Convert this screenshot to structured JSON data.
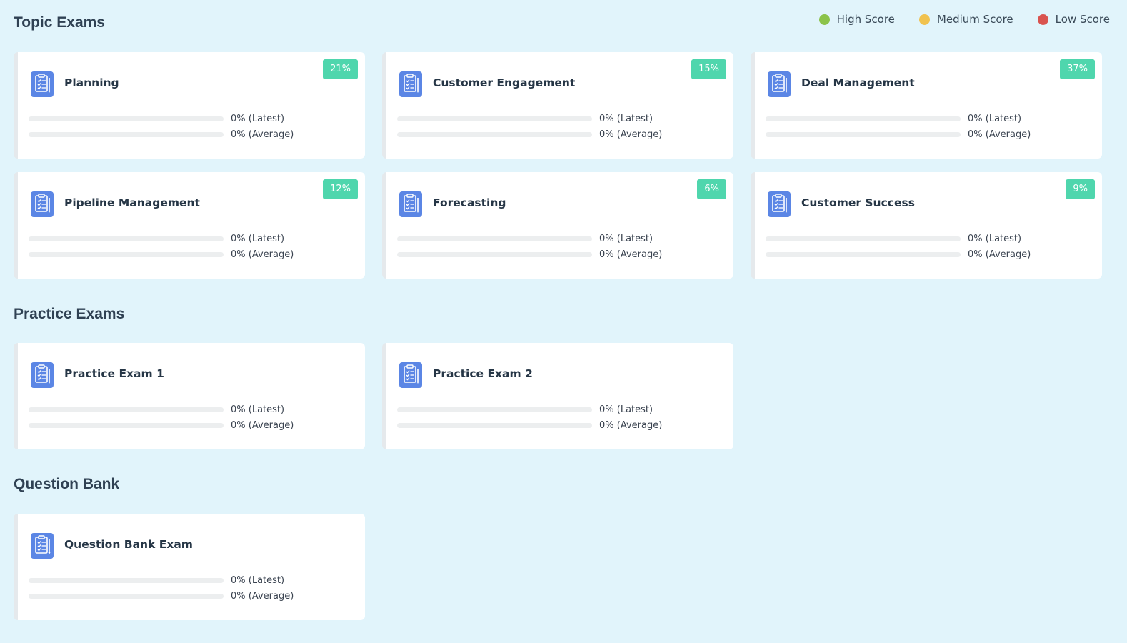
{
  "legend": [
    {
      "label": "High Score",
      "color": "#8bc34a"
    },
    {
      "label": "Medium Score",
      "color": "#f0c24f"
    },
    {
      "label": "Low Score",
      "color": "#d9534f"
    }
  ],
  "sections": {
    "topic": {
      "title": "Topic Exams",
      "cards": [
        {
          "title": "Planning",
          "badge": "21%",
          "latest": "0% (Latest)",
          "average": "0% (Average)",
          "latest_pct": 0,
          "average_pct": 0
        },
        {
          "title": "Customer Engagement",
          "badge": "15%",
          "latest": "0% (Latest)",
          "average": "0% (Average)",
          "latest_pct": 0,
          "average_pct": 0
        },
        {
          "title": "Deal Management",
          "badge": "37%",
          "latest": "0% (Latest)",
          "average": "0% (Average)",
          "latest_pct": 0,
          "average_pct": 0
        },
        {
          "title": "Pipeline Management",
          "badge": "12%",
          "latest": "0% (Latest)",
          "average": "0% (Average)",
          "latest_pct": 0,
          "average_pct": 0
        },
        {
          "title": "Forecasting",
          "badge": "6%",
          "latest": "0% (Latest)",
          "average": "0% (Average)",
          "latest_pct": 0,
          "average_pct": 0
        },
        {
          "title": "Customer Success",
          "badge": "9%",
          "latest": "0% (Latest)",
          "average": "0% (Average)",
          "latest_pct": 0,
          "average_pct": 0
        }
      ]
    },
    "practice": {
      "title": "Practice Exams",
      "cards": [
        {
          "title": "Practice Exam 1",
          "latest": "0% (Latest)",
          "average": "0% (Average)",
          "latest_pct": 0,
          "average_pct": 0
        },
        {
          "title": "Practice Exam 2",
          "latest": "0% (Latest)",
          "average": "0% (Average)",
          "latest_pct": 0,
          "average_pct": 0
        }
      ]
    },
    "bank": {
      "title": "Question Bank",
      "cards": [
        {
          "title": "Question Bank Exam",
          "latest": "0% (Latest)",
          "average": "0% (Average)",
          "latest_pct": 0,
          "average_pct": 0
        }
      ]
    }
  },
  "icons": {
    "card_icon": "clipboard-checklist-icon"
  }
}
